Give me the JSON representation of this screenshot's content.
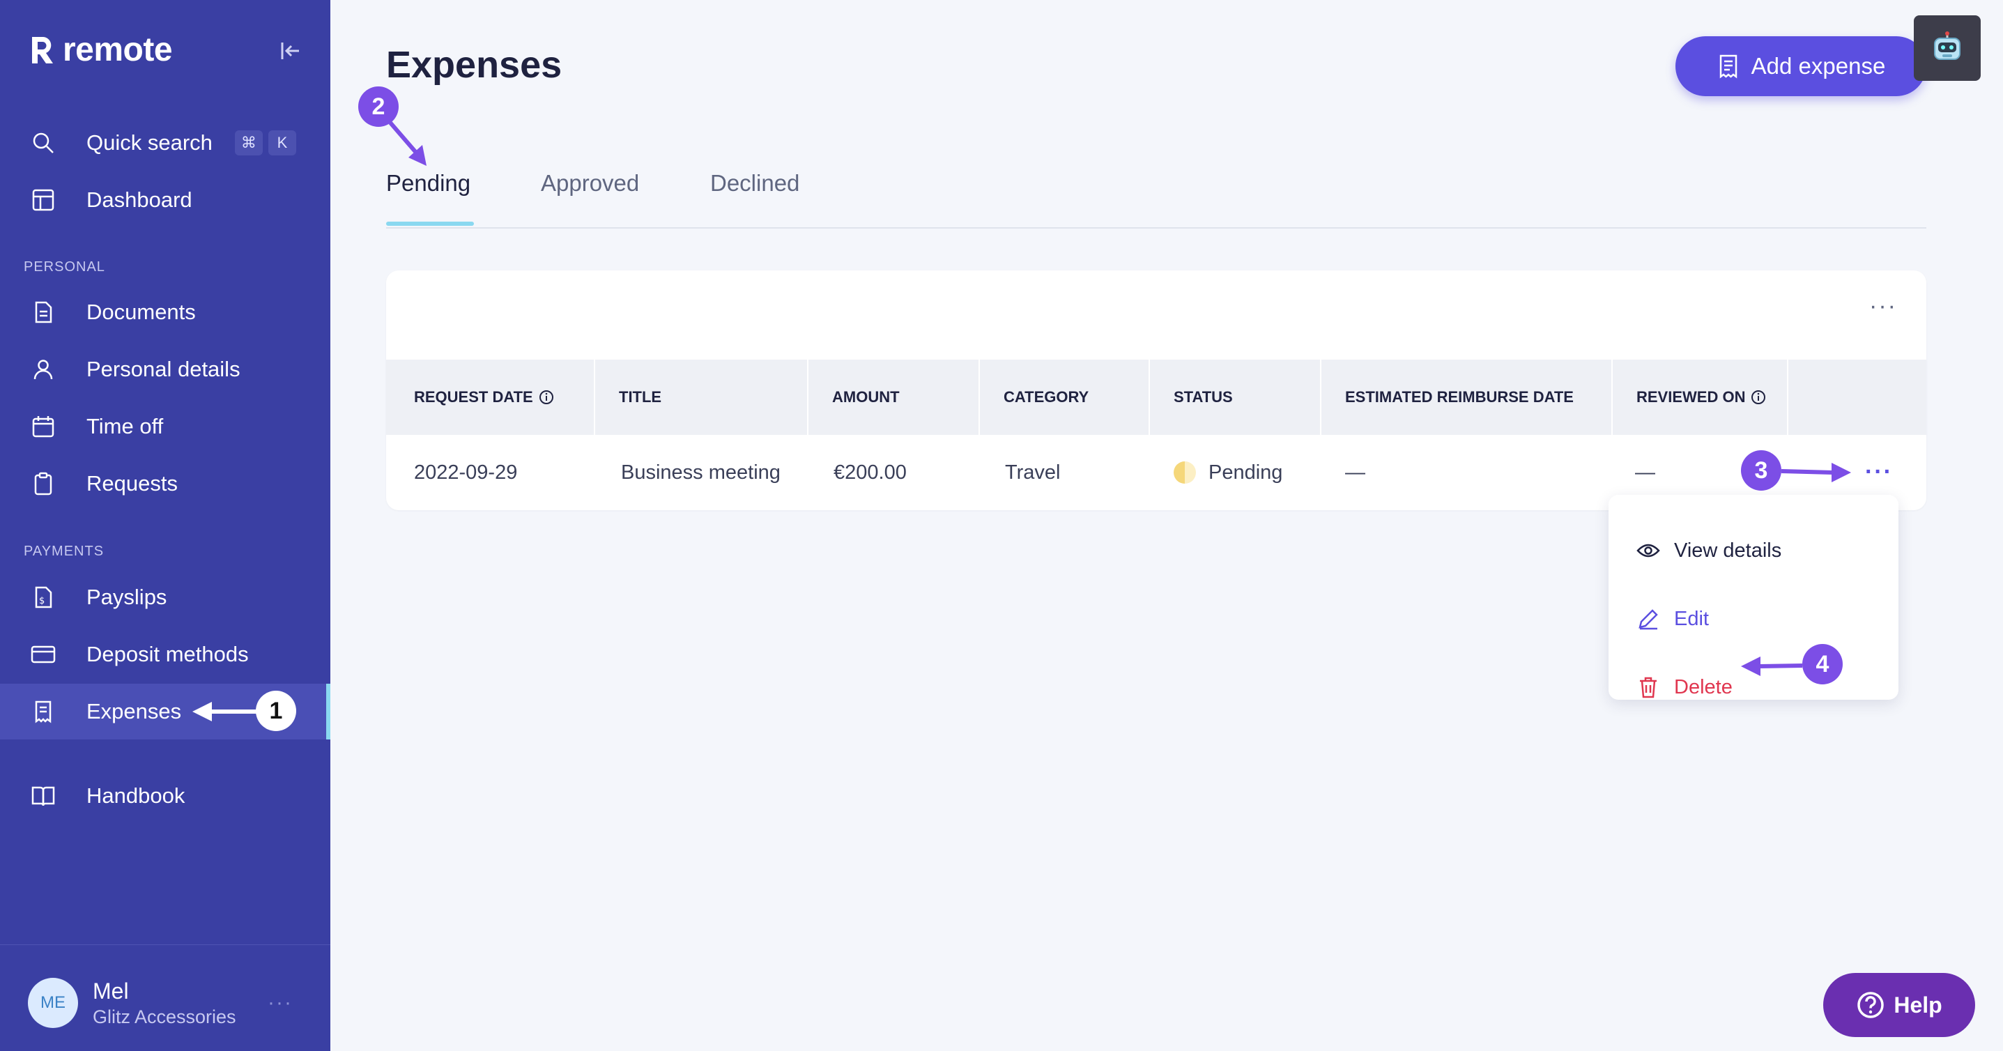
{
  "sidebar": {
    "brand": "remote",
    "nav": [
      {
        "label": "Quick search",
        "icon": "search-icon"
      },
      {
        "label": "Dashboard",
        "icon": "layout-icon"
      },
      {
        "label": "Documents",
        "icon": "document-icon"
      },
      {
        "label": "Personal details",
        "icon": "user-icon"
      },
      {
        "label": "Time off",
        "icon": "calendar-icon"
      },
      {
        "label": "Requests",
        "icon": "clipboard-icon"
      },
      {
        "label": "Payslips",
        "icon": "payslip-icon"
      },
      {
        "label": "Deposit methods",
        "icon": "card-icon"
      },
      {
        "label": "Expenses",
        "icon": "receipt-icon"
      },
      {
        "label": "Handbook",
        "icon": "book-icon"
      }
    ],
    "shortcut_keys": [
      "⌘",
      "K"
    ],
    "sections": {
      "personal": "PERSONAL",
      "payments": "PAYMENTS"
    },
    "active_item": "Expenses",
    "user": {
      "initials": "ME",
      "name": "Mel",
      "company": "Glitz Accessories",
      "more": "···"
    }
  },
  "header": {
    "title": "Expenses",
    "add_button_label": "Add expense"
  },
  "tabs": [
    {
      "label": "Pending",
      "active": true
    },
    {
      "label": "Approved",
      "active": false
    },
    {
      "label": "Declined",
      "active": false
    }
  ],
  "table": {
    "more": "···",
    "columns": [
      "REQUEST DATE",
      "TITLE",
      "AMOUNT",
      "CATEGORY",
      "STATUS",
      "ESTIMATED REIMBURSE DATE",
      "REVIEWED ON"
    ],
    "rows": [
      {
        "request_date": "2022-09-29",
        "title": "Business meeting",
        "amount": "€200.00",
        "category": "Travel",
        "status": "Pending",
        "estimated_reimburse_date": "—",
        "reviewed_on": "—"
      }
    ],
    "row_more": "···"
  },
  "row_menu": {
    "items": [
      {
        "label": "View details",
        "icon": "eye-icon",
        "color": "#1f2240"
      },
      {
        "label": "Edit",
        "icon": "pencil-icon",
        "color": "#5b4fe0"
      },
      {
        "label": "Delete",
        "icon": "trash-icon",
        "color": "#e0364f"
      }
    ]
  },
  "help_button_label": "Help",
  "annotations": [
    "1",
    "2",
    "3",
    "4"
  ],
  "colors": {
    "sidebar": "#3a3fa3",
    "accent": "#5b4fe0",
    "danger": "#e0364f",
    "help": "#6a2fb0",
    "tab_underline": "#8ad8f0"
  }
}
